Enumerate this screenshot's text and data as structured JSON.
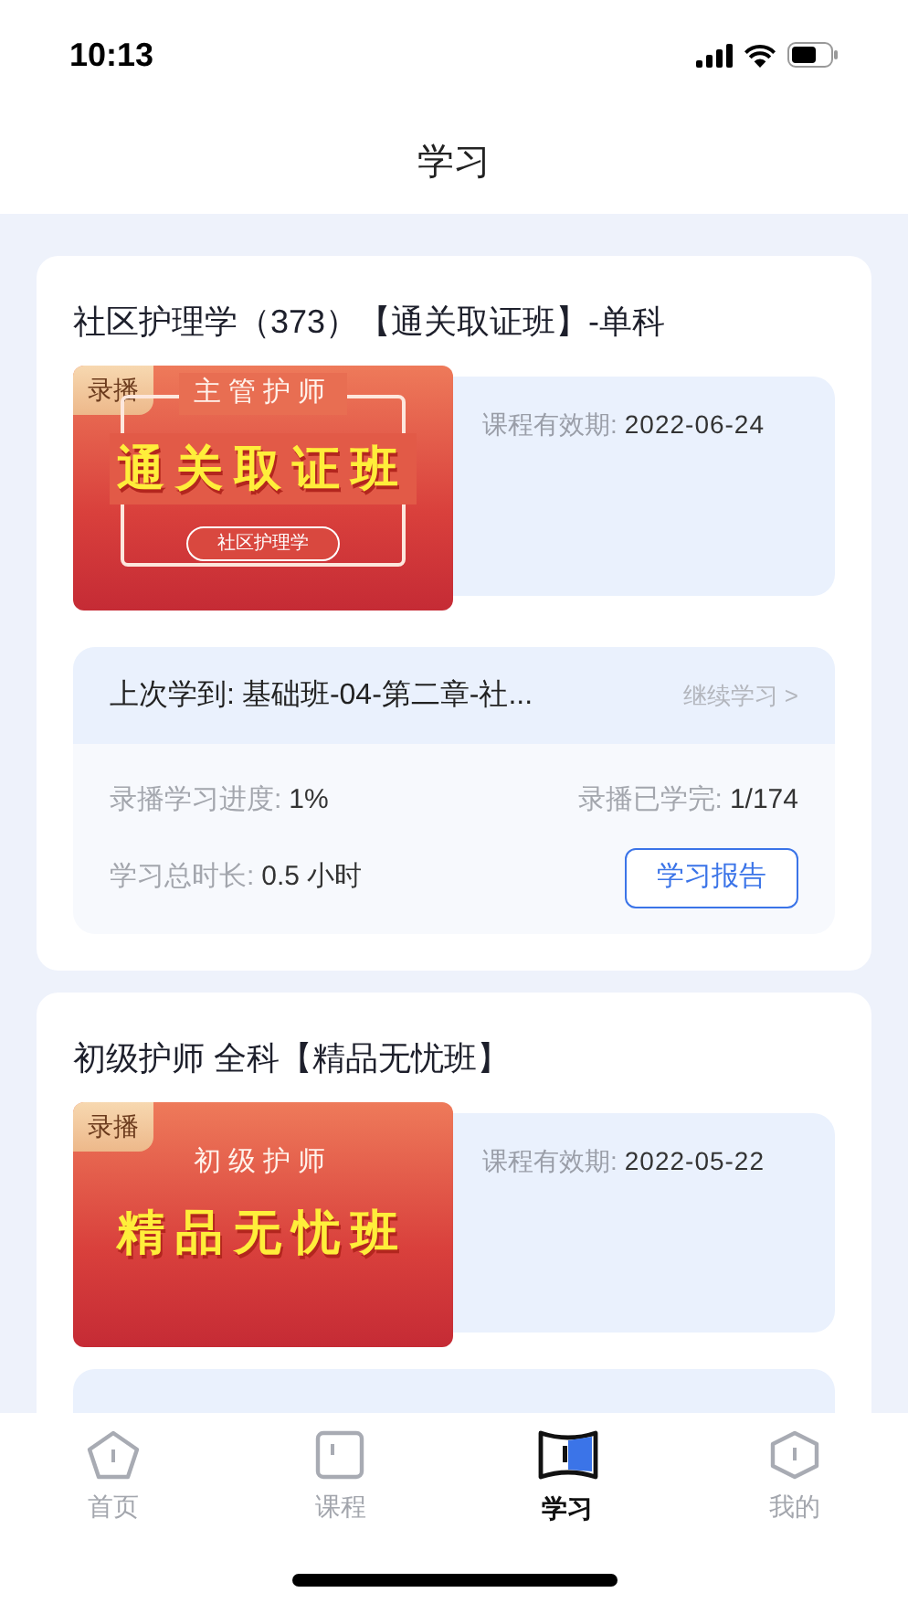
{
  "status_bar": {
    "time": "10:13"
  },
  "header": {
    "title": "学习"
  },
  "courses": [
    {
      "title": "社区护理学（373）【通关取证班】-单科",
      "cover": {
        "badge": "录播",
        "top_line": "主管护师",
        "headline": "通关取证班",
        "tag": "社区护理学"
      },
      "validity_label": "课程有效期:",
      "validity_date": "2022-06-24",
      "last_study": {
        "label": "上次学到:",
        "value": "基础班-04-第二章-社...",
        "action": "继续学习 >"
      },
      "stats": [
        {
          "label": "录播学习进度:",
          "value": "1%"
        },
        {
          "label": "录播已学完:",
          "value": "1/174"
        },
        {
          "label": "学习总时长:",
          "value": "0.5 小时"
        }
      ],
      "report_button": "学习报告"
    },
    {
      "title": "初级护师 全科【精品无忧班】",
      "cover": {
        "badge": "录播",
        "top_line": "初级护师",
        "headline": "精品无忧班"
      },
      "validity_label": "课程有效期:",
      "validity_date": "2022-05-22"
    }
  ],
  "tab_bar": [
    {
      "kind": "home",
      "label": "首页",
      "selected": false
    },
    {
      "kind": "course",
      "label": "课程",
      "selected": false
    },
    {
      "kind": "study",
      "label": "学习",
      "selected": true
    },
    {
      "kind": "me",
      "label": "我的",
      "selected": false
    }
  ]
}
